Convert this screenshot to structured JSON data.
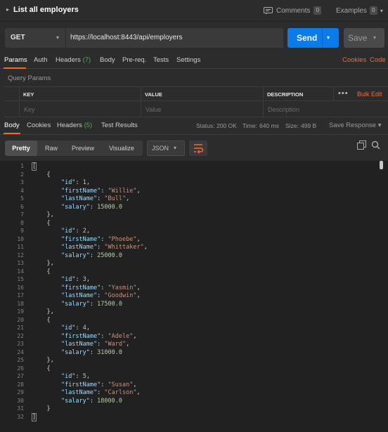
{
  "header": {
    "title": "List all employers",
    "comments_label": "Comments",
    "comments_count": "0",
    "examples_label": "Examples",
    "examples_count": "0"
  },
  "request": {
    "method": "GET",
    "url": "https://localhost:8443/api/employers",
    "send_label": "Send",
    "save_label": "Save"
  },
  "request_tabs": {
    "params": "Params",
    "auth": "Auth",
    "headers": "Headers",
    "headers_count": "(7)",
    "body": "Body",
    "prereq": "Pre-req.",
    "tests": "Tests",
    "settings": "Settings",
    "cookies": "Cookies",
    "code": "Code"
  },
  "query_params": {
    "label": "Query Params",
    "headers": {
      "key": "KEY",
      "value": "VALUE",
      "description": "DESCRIPTION"
    },
    "more_icon": "more-horizontal-icon",
    "bulk_edit": "Bulk Edit",
    "placeholders": {
      "key": "Key",
      "value": "Value",
      "description": "Description"
    }
  },
  "response_tabs": {
    "body": "Body",
    "cookies": "Cookies",
    "headers": "Headers",
    "headers_count": "(5)",
    "test_results": "Test Results",
    "status_label": "Status:",
    "status_value": "200 OK",
    "time_label": "Time:",
    "time_value": "640 ms",
    "size_label": "Size:",
    "size_value": "499 B",
    "save_response": "Save Response"
  },
  "response_toolbar": {
    "pretty": "Pretty",
    "raw": "Raw",
    "preview": "Preview",
    "visualize": "Visualize",
    "format": "JSON"
  },
  "colors": {
    "accent": "#f26b3a",
    "send": "#097bed",
    "status_ok": "#4caf50"
  },
  "employees": [
    {
      "id": "1",
      "firstName": "\"Willie\"",
      "lastName": "\"Bull\"",
      "salary": "15000.0"
    },
    {
      "id": "2",
      "firstName": "\"Phoebe\"",
      "lastName": "\"Whittaker\"",
      "salary": "25000.0"
    },
    {
      "id": "3",
      "firstName": "\"Yasmin\"",
      "lastName": "\"Goodwin\"",
      "salary": "17500.0"
    },
    {
      "id": "4",
      "firstName": "\"Adele\"",
      "lastName": "\"Ward\"",
      "salary": "31000.0"
    },
    {
      "id": "5",
      "firstName": "\"Susan\"",
      "lastName": "\"Carlson\"",
      "salary": "18000.0"
    }
  ],
  "json_keys": {
    "id": "\"id\"",
    "firstName": "\"firstName\"",
    "lastName": "\"lastName\"",
    "salary": "\"salary\""
  },
  "line_count": 32
}
